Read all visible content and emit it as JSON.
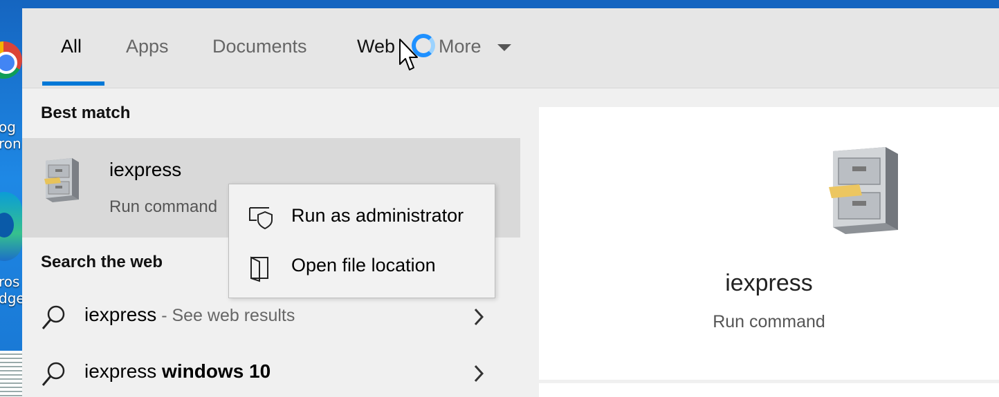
{
  "desktop": {
    "chrome_label": "og\nron",
    "edge_label": "ros\ndge"
  },
  "tabs": [
    {
      "label": "All",
      "active": true
    },
    {
      "label": "Apps",
      "active": false
    },
    {
      "label": "Documents",
      "active": false
    },
    {
      "label": "Web",
      "active": false
    },
    {
      "label": "More",
      "active": false
    }
  ],
  "results": {
    "best_match_title": "Best match",
    "best_match": {
      "name": "iexpress",
      "subtitle": "Run command",
      "icon": "filing-cabinet-icon"
    },
    "web_section_title": "Search the web",
    "web_results": [
      {
        "query": "iexpress",
        "suffix": " - See web results",
        "bold_part": ""
      },
      {
        "query": "iexpress ",
        "suffix": "",
        "bold_part": "windows 10"
      }
    ]
  },
  "context_menu": {
    "items": [
      {
        "label": "Run as administrator",
        "icon": "shield-run-icon"
      },
      {
        "label": "Open file location",
        "icon": "folder-open-icon"
      }
    ]
  },
  "preview": {
    "name": "iexpress",
    "subtitle": "Run command",
    "icon": "filing-cabinet-icon"
  },
  "colors": {
    "accent": "#0078d7",
    "selected_row": "#d9d9d9",
    "panel_bg": "#f0f0f0"
  }
}
